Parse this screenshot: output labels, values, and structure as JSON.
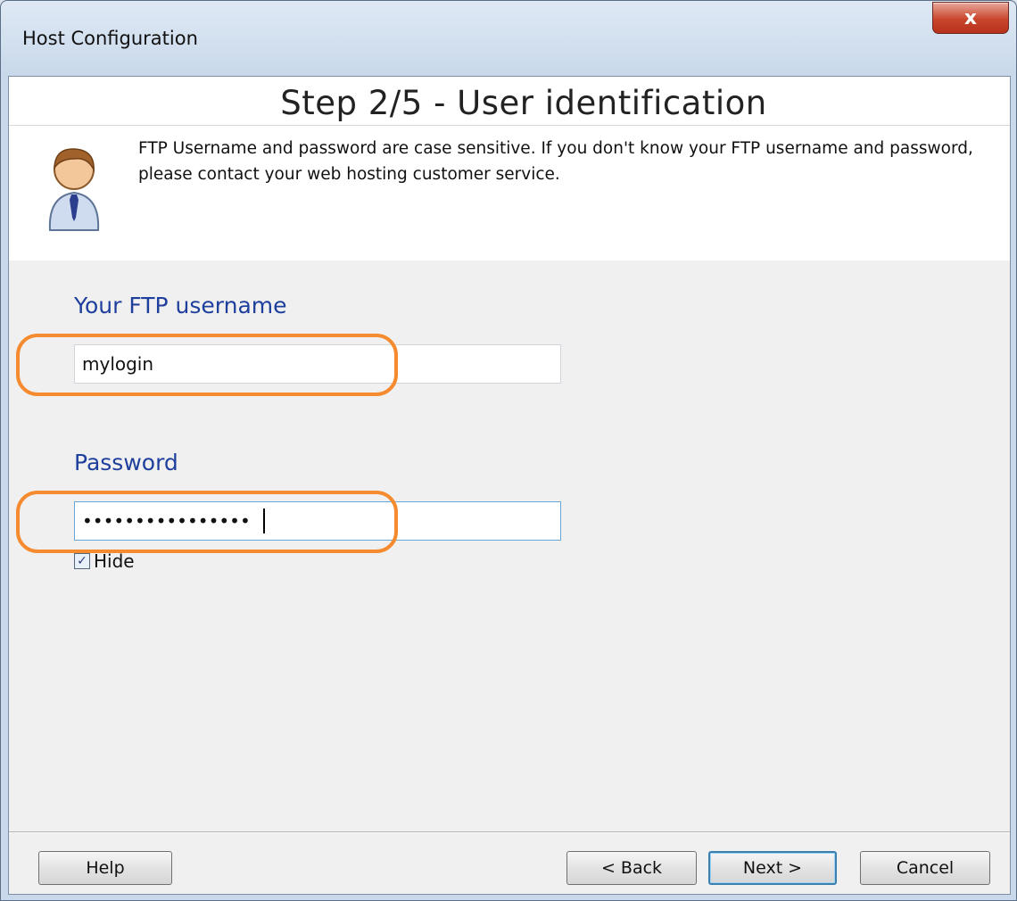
{
  "window": {
    "title": "Host Configuration",
    "close_label": "x"
  },
  "header": {
    "step_title": "Step 2/5 - User identification",
    "info": "FTP Username and password are case sensitive. If you don't know your FTP username and password, please contact your web hosting customer service.",
    "icon": "user-icon"
  },
  "form": {
    "username_label": "Your FTP username",
    "username_value": "mylogin",
    "password_label": "Password",
    "password_value": "••••••••••••••••",
    "hide_label": "Hide",
    "hide_checked": true
  },
  "buttons": {
    "help": "Help",
    "back": "< Back",
    "next": "Next >",
    "cancel": "Cancel"
  },
  "colors": {
    "highlight": "#f58a2e",
    "label_blue": "#1f3f9c"
  }
}
